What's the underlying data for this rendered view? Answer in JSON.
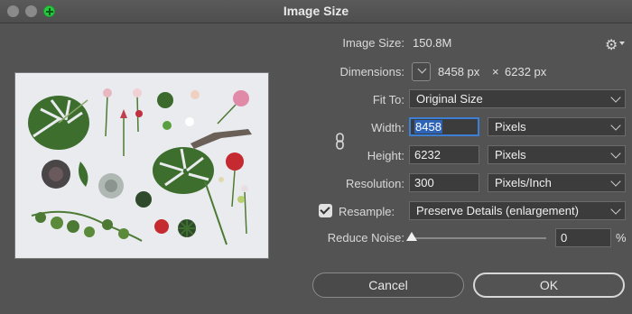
{
  "window": {
    "title": "Image Size"
  },
  "image_size": {
    "label": "Image Size:",
    "value": "150.8M"
  },
  "dimensions": {
    "label": "Dimensions:",
    "width": "8458 px",
    "times": "×",
    "height": "6232 px"
  },
  "fit_to": {
    "label": "Fit To:",
    "value": "Original Size"
  },
  "width": {
    "label": "Width:",
    "value": "8458",
    "unit": "Pixels"
  },
  "height": {
    "label": "Height:",
    "value": "6232",
    "unit": "Pixels"
  },
  "resolution": {
    "label": "Resolution:",
    "value": "300",
    "unit": "Pixels/Inch"
  },
  "resample": {
    "label": "Resample:",
    "checked": true,
    "value": "Preserve Details (enlargement)"
  },
  "reduce_noise": {
    "label": "Reduce Noise:",
    "value": "0",
    "unit": "%",
    "level": 0
  },
  "buttons": {
    "cancel": "Cancel",
    "ok": "OK"
  },
  "icons": [
    "gear-icon",
    "chain-link-icon",
    "chevron-down-icon",
    "checkmark-icon",
    "slider-thumb-icon"
  ]
}
